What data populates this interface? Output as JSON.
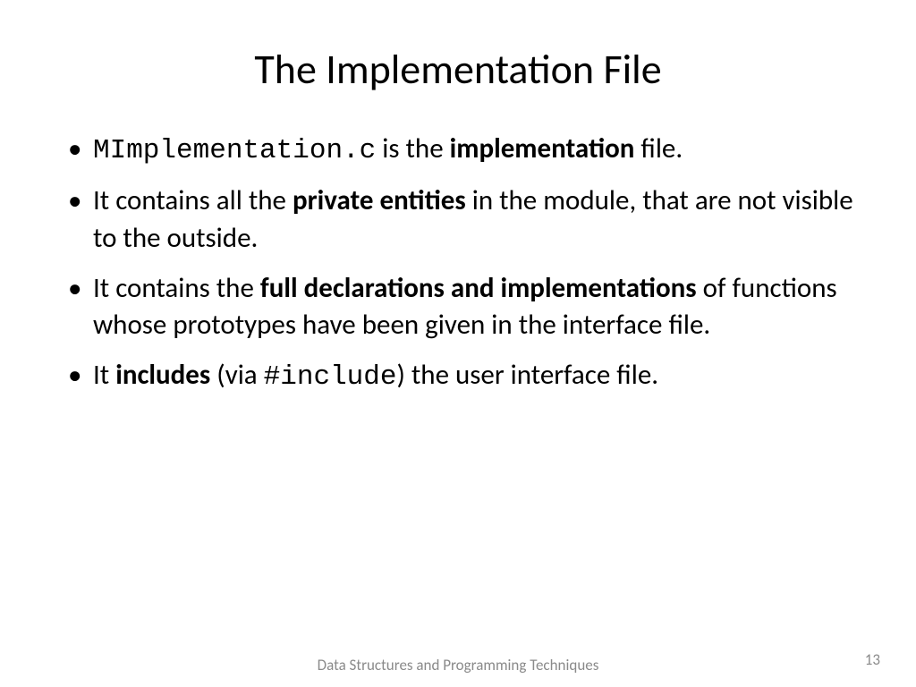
{
  "title": "The Implementation File",
  "bullets": [
    {
      "code": "MImplementation.c",
      "mid": " is the ",
      "bold": "implementation",
      "tail": " file."
    },
    {
      "lead": "It contains all the ",
      "bold": "private entities",
      "tail": " in the module, that are not visible to the outside."
    },
    {
      "lead": "It contains the ",
      "bold": "full declarations and implementations",
      "tail": " of functions whose prototypes have been given in the interface file."
    },
    {
      "lead": "It ",
      "bold": "includes",
      "mid": " (via ",
      "code": "#include",
      "tail": ") the user interface file."
    }
  ],
  "footer": "Data Structures and Programming Techniques",
  "page": "13"
}
